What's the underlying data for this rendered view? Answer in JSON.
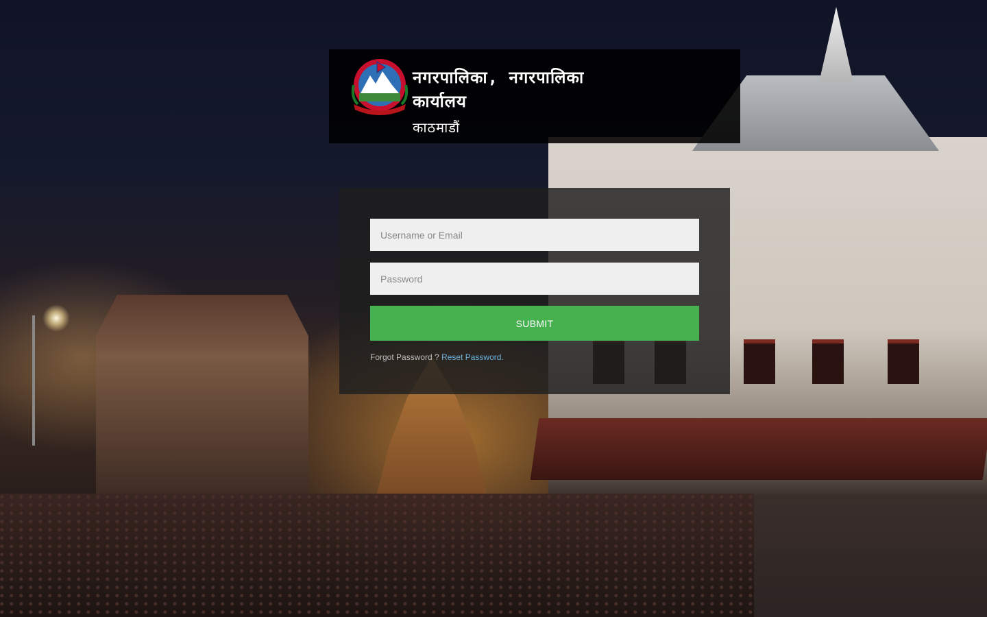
{
  "header": {
    "org_title": "नगरपालिका, नगरपालिका कार्यालय",
    "org_location": "काठमाडौं",
    "emblem": "nepal-government-emblem"
  },
  "login": {
    "username_placeholder": "Username or Email",
    "password_placeholder": "Password",
    "submit_label": "SUBMIT",
    "forgot_text": "Forgot Password ?",
    "reset_link": "Reset Password."
  },
  "colors": {
    "submit_bg": "#47b04f",
    "link": "#6bb0dd",
    "panel_bg": "rgba(30,30,30,0.82)"
  }
}
